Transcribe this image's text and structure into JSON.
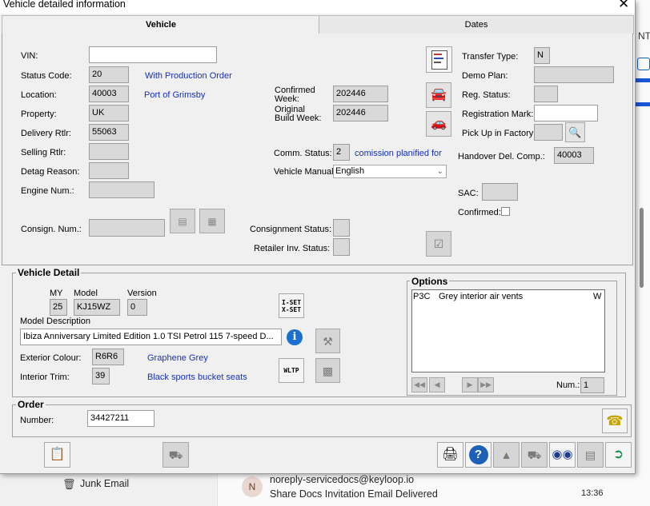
{
  "window": {
    "title": "Vehicle detailed information"
  },
  "tabs": [
    "Vehicle",
    "Dates"
  ],
  "vehicle": {
    "vin_label": "VIN:",
    "vin": "",
    "status_code_label": "Status Code:",
    "status_code": "20",
    "status_text": "With Production Order",
    "location_label": "Location:",
    "location": "40003",
    "location_text": "Port of Grimsby",
    "property_label": "Property:",
    "property": "UK",
    "delivery_rtlr_label": "Delivery Rtlr:",
    "delivery_rtlr": "55063",
    "selling_rtlr_label": "Selling Rtlr:",
    "selling_rtlr": "",
    "detag_reason_label": "Detag Reason:",
    "detag_reason": "",
    "engine_num_label": "Engine Num.:",
    "engine_num": "",
    "consign_num_label": "Consign. Num.:",
    "consign_num": "",
    "confirmed_week_label_1": "Confirmed",
    "confirmed_week_label_2": "Week:",
    "confirmed_week": "202446",
    "original_build_week_label_1": "Original",
    "original_build_week_label_2": "Build Week:",
    "original_build_week": "202446",
    "comm_status_label": "Comm. Status:",
    "comm_status": "2",
    "comm_status_text": "comission planified for",
    "vehicle_manual_label": "Vehicle Manual",
    "vehicle_manual": "English",
    "consignment_status_label": "Consignment Status:",
    "consignment_status": "",
    "retailer_inv_status_label": "Retailer Inv. Status:",
    "retailer_inv_status": "",
    "transfer_type_label": "Transfer Type:",
    "transfer_type": "N",
    "demo_plan_label": "Demo Plan:",
    "demo_plan": "",
    "reg_status_label": "Reg. Status:",
    "reg_status": "",
    "registration_mark_label": "Registration Mark:",
    "registration_mark": "",
    "pick_up_label": "Pick Up in Factory:",
    "pick_up": "",
    "handover_label": "Handover Del. Comp.:",
    "handover": "40003",
    "sac_label": "SAC:",
    "sac": "",
    "confirmed_label": "Confirmed:"
  },
  "vehicle_detail": {
    "section_title": "Vehicle Detail",
    "my_label": "MY",
    "my": "25",
    "model_label": "Model",
    "model": "KJ15WZ",
    "version_label": "Version",
    "version": "0",
    "model_description_label": "Model Description",
    "model_description": "Ibiza Anniversary Limited Edition 1.0 TSI Petrol 115 7-speed D...",
    "exterior_colour_label": "Exterior Colour:",
    "exterior_colour": "R6R6",
    "exterior_colour_text": "Graphene Grey",
    "interior_trim_label": "Interior Trim:",
    "interior_trim": "39",
    "interior_trim_text": "Black sports bucket seats",
    "iset_label_1": "I-SET",
    "iset_label_2": "X-SET",
    "wltp_label": "WLTP"
  },
  "options": {
    "section_title": "Options",
    "items": [
      {
        "code": "P3C",
        "description": "Grey interior air vents",
        "flag": "W"
      }
    ],
    "num_label": "Num.:",
    "num": "1"
  },
  "order": {
    "section_title": "Order",
    "number_label": "Number:",
    "number": "34427211"
  },
  "background": {
    "folder": "Junk Email",
    "sender_initial": "N",
    "sender": "noreply-servicedocs@keyloop.io",
    "subject": "Share Docs Invitation Email Delivered",
    "time": "13:36",
    "right_fragment": "NT"
  },
  "colors": {
    "link_blue": "#1830b8",
    "field_grey": "#d9d9d9",
    "dialog_bg": "#f0f0f0"
  }
}
